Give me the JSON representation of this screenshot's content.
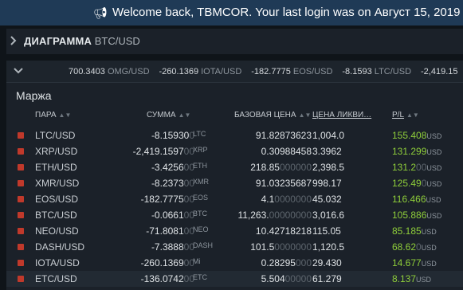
{
  "banner": {
    "icon": "megaphone-icon",
    "text": "Welcome back, TBMCOR. Your last login was on Август 15, 2019 C"
  },
  "chart_panel": {
    "title": "ДИАГРАММА",
    "pair": "BTC/USD"
  },
  "ticker": [
    {
      "value": "700.3403",
      "symbol": "OMG/USD"
    },
    {
      "value": "-260.1369",
      "symbol": "IOTA/USD"
    },
    {
      "value": "-182.7775",
      "symbol": "EOS/USD"
    },
    {
      "value": "-8.1593",
      "symbol": "LTC/USD"
    },
    {
      "value": "-2,419.15",
      "symbol": ""
    }
  ],
  "margin": {
    "title": "Маржа",
    "columns": {
      "pair": "ПАРА",
      "sum": "СУММА",
      "base_price": "БАЗОВАЯ ЦЕНА",
      "liq_price": "ЦЕНА ЛИКВИ…",
      "pl": "P/L"
    },
    "rows": [
      {
        "pair": "LTC/USD",
        "sum": "-8.15930",
        "sum_dim": "0",
        "cur": "LTC",
        "base": "91.82873623",
        "base_dim": "",
        "liq": "1,004.0",
        "pl": "155.408",
        "pl_dim": "",
        "pl_unit": "USD"
      },
      {
        "pair": "XRP/USD",
        "sum": "-2,419.1597",
        "sum_dim": "00",
        "cur": "XRP",
        "base": "0.30988458",
        "base_dim": "",
        "liq": "3.3962",
        "pl": "131.299",
        "pl_dim": "",
        "pl_unit": "USD"
      },
      {
        "pair": "ETH/USD",
        "sum": "-3.4256",
        "sum_dim": "00",
        "cur": "ETH",
        "base": "218.85",
        "base_dim": "000000",
        "liq": "2,398.5",
        "pl": "131.2",
        "pl_dim": "00",
        "pl_unit": "USD"
      },
      {
        "pair": "XMR/USD",
        "sum": "-8.2373",
        "sum_dim": "00",
        "cur": "XMR",
        "base": "91.03235687",
        "base_dim": "",
        "liq": "998.17",
        "pl": "125.49",
        "pl_dim": "0",
        "pl_unit": "USD"
      },
      {
        "pair": "EOS/USD",
        "sum": "-182.7775",
        "sum_dim": "00",
        "cur": "EOS",
        "base": "4.1",
        "base_dim": "0000000",
        "liq": "45.032",
        "pl": "116.466",
        "pl_dim": "",
        "pl_unit": "USD"
      },
      {
        "pair": "BTC/USD",
        "sum": "-0.0661",
        "sum_dim": "00",
        "cur": "BTC",
        "base": "11,263.",
        "base_dim": "00000000",
        "liq": "3,016.6",
        "pl": "105.886",
        "pl_dim": "",
        "pl_unit": "USD"
      },
      {
        "pair": "NEO/USD",
        "sum": "-71.8081",
        "sum_dim": "00",
        "cur": "NEO",
        "base": "10.42718218",
        "base_dim": "",
        "liq": "115.05",
        "pl": "85.185",
        "pl_dim": "",
        "pl_unit": "USD"
      },
      {
        "pair": "DASH/USD",
        "sum": "-7.3888",
        "sum_dim": "00",
        "cur": "DASH",
        "base": "101.5",
        "base_dim": "0000000",
        "liq": "1,120.5",
        "pl": "68.62",
        "pl_dim": "0",
        "pl_unit": "USD"
      },
      {
        "pair": "IOTA/USD",
        "sum": "-260.1369",
        "sum_dim": "00",
        "cur": "Mi",
        "base": "0.28295",
        "base_dim": "000",
        "liq": "29.430",
        "pl": "14.677",
        "pl_dim": "",
        "pl_unit": "USD"
      },
      {
        "pair": "ETC/USD",
        "sum": "-136.0742",
        "sum_dim": "00",
        "cur": "ETC",
        "base": "5.504",
        "base_dim": "00000",
        "liq": "61.279",
        "pl": "8.137",
        "pl_dim": "",
        "pl_unit": "USD"
      }
    ]
  },
  "colors": {
    "banner_bg": "#1f3a56",
    "panel_bg": "#1b2129",
    "page_bg": "#0f1419",
    "profit": "#8fce3a",
    "position_marker": "#c0392b"
  }
}
